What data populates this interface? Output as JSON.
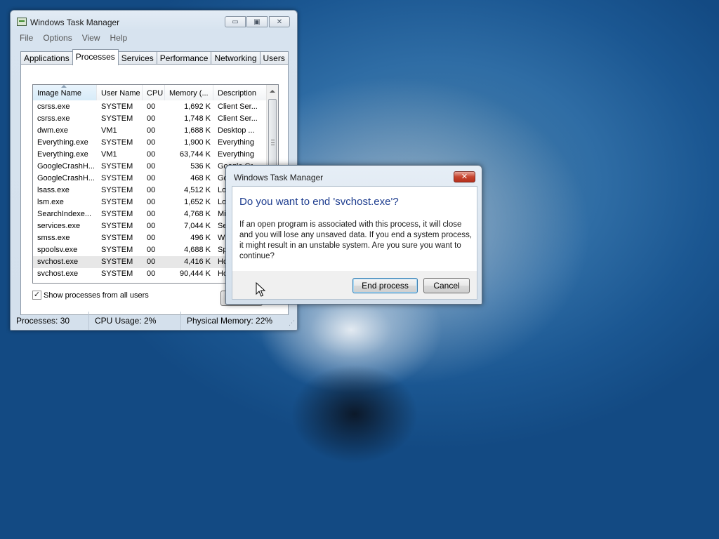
{
  "task_manager": {
    "title": "Windows Task Manager",
    "caption_buttons": {
      "minimize": "▭",
      "maximize": "▣",
      "close": "✕"
    },
    "menu": [
      "File",
      "Options",
      "View",
      "Help"
    ],
    "tabs": [
      "Applications",
      "Processes",
      "Services",
      "Performance",
      "Networking",
      "Users"
    ],
    "active_tab": "Processes",
    "columns": [
      "Image Name",
      "User Name",
      "CPU",
      "Memory (...",
      "Description"
    ],
    "processes": [
      [
        "csrss.exe",
        "SYSTEM",
        "00",
        "1,692 K",
        "Client Ser..."
      ],
      [
        "csrss.exe",
        "SYSTEM",
        "00",
        "1,748 K",
        "Client Ser..."
      ],
      [
        "dwm.exe",
        "VM1",
        "00",
        "1,688 K",
        "Desktop ..."
      ],
      [
        "Everything.exe",
        "SYSTEM",
        "00",
        "1,900 K",
        "Everything"
      ],
      [
        "Everything.exe",
        "VM1",
        "00",
        "63,744 K",
        "Everything"
      ],
      [
        "GoogleCrashH...",
        "SYSTEM",
        "00",
        "536 K",
        "Google Cr..."
      ],
      [
        "GoogleCrashH...",
        "SYSTEM",
        "00",
        "468 K",
        "Go"
      ],
      [
        "lsass.exe",
        "SYSTEM",
        "00",
        "4,512 K",
        "Loc"
      ],
      [
        "lsm.exe",
        "SYSTEM",
        "00",
        "1,652 K",
        "Loc"
      ],
      [
        "SearchIndexe...",
        "SYSTEM",
        "00",
        "4,768 K",
        "Mic"
      ],
      [
        "services.exe",
        "SYSTEM",
        "00",
        "7,044 K",
        "Ser"
      ],
      [
        "smss.exe",
        "SYSTEM",
        "00",
        "496 K",
        "Wi"
      ],
      [
        "spoolsv.exe",
        "SYSTEM",
        "00",
        "4,688 K",
        "Sp"
      ],
      [
        "svchost.exe",
        "SYSTEM",
        "00",
        "4,416 K",
        "Ho"
      ],
      [
        "svchost.exe",
        "SYSTEM",
        "00",
        "90,444 K",
        "Ho"
      ]
    ],
    "selected_row": 13,
    "show_all_label": "Show processes from all users",
    "show_all_checked": "✓",
    "end_process_partial": "E",
    "status": {
      "processes": "Processes: 30",
      "cpu": "CPU Usage: 2%",
      "memory": "Physical Memory: 22%"
    }
  },
  "dialog": {
    "title": "Windows Task Manager",
    "close_glyph": "✕",
    "heading": "Do you want to end 'svchost.exe'?",
    "message": "If an open program is associated with this process, it will close and you will lose any unsaved data. If you end a system process, it might result in an unstable system. Are you sure you want to continue?",
    "end_button": "End process",
    "cancel_button": "Cancel"
  }
}
